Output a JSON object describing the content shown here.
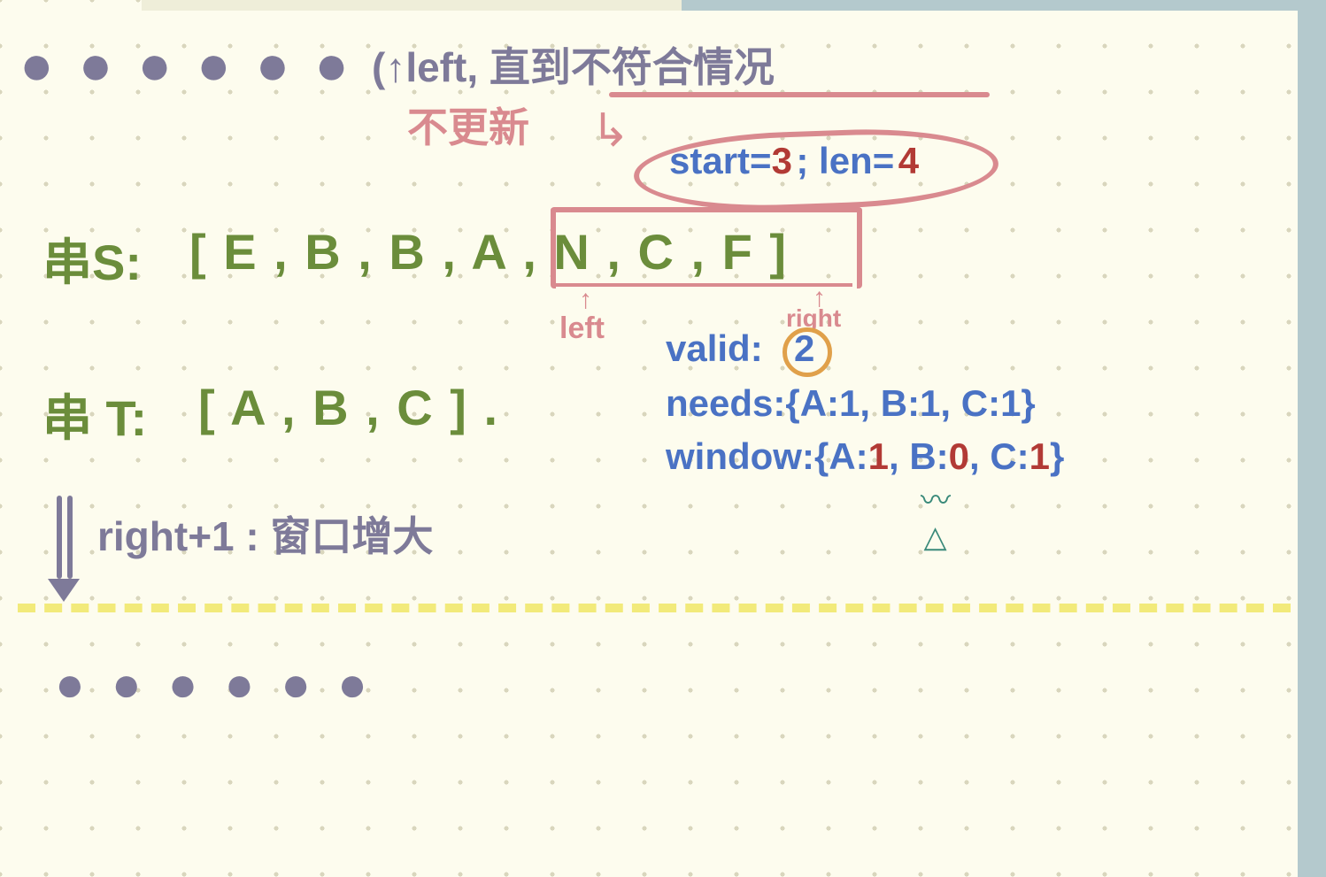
{
  "top_note": "(↑left, 直到不符合情况",
  "no_update_label": "不更新",
  "arrow_hook": "↳",
  "result": {
    "start_label": "start=",
    "start_value": "3",
    "sep": "; len=",
    "len_value": "4"
  },
  "s_label": "串S:",
  "s_array": "[ E ,  B ,  B ,  A ,  N ,  C ,  F ]",
  "s_items": [
    "E",
    "B",
    "B",
    "A",
    "N",
    "C",
    "F"
  ],
  "left_marker": "left",
  "right_marker": "right",
  "t_label": "串 T:",
  "t_array": "[ A ,  B ,  C ] .",
  "t_items": [
    "A",
    "B",
    "C"
  ],
  "valid_label": "valid:",
  "valid_value": "2",
  "needs_label": "needs:",
  "needs_body": "{A:1, B:1, C:1}",
  "window_label": "window:",
  "window_body_prefix": "{A:",
  "window_a": "1",
  "window_mid1": ", B:",
  "window_b": "0",
  "window_mid2": ", C:",
  "window_c": "1",
  "window_body_suffix": "}",
  "step_label": "right+1 : 窗口增大",
  "dots": "● ● ● ● ● ●"
}
